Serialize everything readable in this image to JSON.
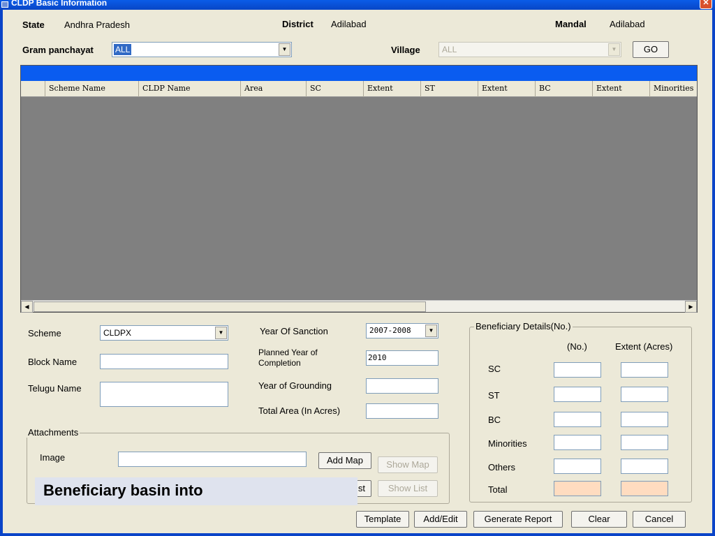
{
  "window": {
    "title": "CLDP Basic Information",
    "close_glyph": "✕"
  },
  "header": {
    "state_label": "State",
    "state_value": "Andhra Pradesh",
    "district_label": "District",
    "district_value": "Adilabad",
    "mandal_label": "Mandal",
    "mandal_value": "Adilabad",
    "gram_panchayat_label": "Gram panchayat",
    "gram_panchayat_value": "ALL",
    "village_label": "Village",
    "village_value": "ALL",
    "go_label": "GO"
  },
  "grid": {
    "columns": [
      "Scheme Name",
      "CLDP Name",
      "Area",
      "SC",
      "Extent",
      "ST",
      "Extent",
      "BC",
      "Extent",
      "Minorities"
    ],
    "rows": []
  },
  "form": {
    "scheme_label": "Scheme",
    "scheme_value": "CLDPX",
    "block_name_label": "Block Name",
    "block_name_value": "",
    "telugu_name_label": "Telugu Name",
    "telugu_name_value": "",
    "year_of_sanction_label": "Year Of Sanction",
    "year_of_sanction_value": "2007-2008",
    "planned_year_label": "Planned Year of Completion",
    "planned_year_value": "2010",
    "year_of_grounding_label": "Year of Grounding",
    "year_of_grounding_value": "",
    "total_area_label": "Total Area (In Acres)",
    "total_area_value": ""
  },
  "beneficiary": {
    "group_title": "Beneficiary Details(No.)",
    "col_no": "(No.)",
    "col_extent": "Extent (Acres)",
    "rows": [
      "SC",
      "ST",
      "BC",
      "Minorities",
      "Others",
      "Total"
    ],
    "total_fill_color": "#ffdcc0"
  },
  "attachments": {
    "group_title": "Attachments",
    "image_label": "Image",
    "image_value": "",
    "add_map_label": "Add Map",
    "show_map_label": "Show Map",
    "add_list_label": "st",
    "show_list_label": "Show List"
  },
  "footer_buttons": {
    "template": "Template",
    "add_edit": "Add/Edit",
    "generate_report": "Generate Report",
    "clear": "Clear",
    "cancel": "Cancel"
  },
  "overlay_caption": "Beneficiary basin into",
  "icons": {
    "dropdown": "▼",
    "scroll_left": "◀",
    "scroll_right": "▶"
  },
  "colors": {
    "accent": "#0a5cf0",
    "grid_bg": "#808080",
    "dialog_bg": "#ece9d8"
  }
}
